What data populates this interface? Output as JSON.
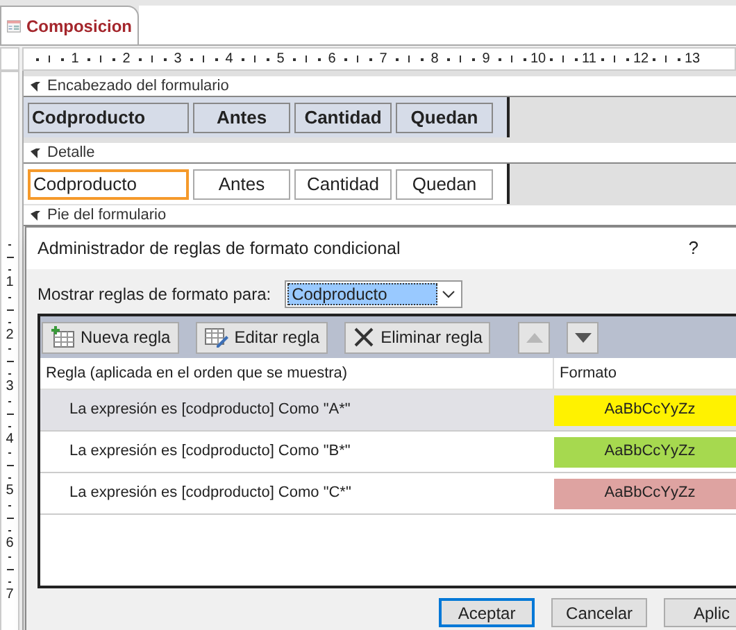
{
  "document_tab": {
    "title": "Composicion"
  },
  "ruler": {
    "top_marks": [
      "1",
      "2",
      "3",
      "4",
      "5",
      "6",
      "7",
      "8",
      "9",
      "10",
      "11",
      "12",
      "13"
    ],
    "side_marks": [
      "1",
      "2",
      "3",
      "4",
      "5",
      "6",
      "7"
    ]
  },
  "form": {
    "sections": [
      {
        "title": "Encabezado del formulario",
        "kind": "header",
        "controls": [
          {
            "text": "Codproducto",
            "selected": false
          },
          {
            "text": "Antes",
            "selected": false
          },
          {
            "text": "Cantidad",
            "selected": false
          },
          {
            "text": "Quedan",
            "selected": false
          }
        ]
      },
      {
        "title": "Detalle",
        "kind": "detail",
        "controls": [
          {
            "text": "Codproducto",
            "selected": true
          },
          {
            "text": "Antes",
            "selected": false
          },
          {
            "text": "Cantidad",
            "selected": false
          },
          {
            "text": "Quedan",
            "selected": false
          }
        ]
      },
      {
        "title": "Pie del formulario",
        "kind": "footer"
      }
    ]
  },
  "dialog": {
    "title": "Administrador de reglas de formato condicional",
    "help": "?",
    "show_label": "Mostrar reglas de formato para:",
    "show_value": "Codproducto",
    "toolbar": [
      {
        "kind": "new",
        "label": "Nueva regla",
        "disabled": false
      },
      {
        "kind": "edit",
        "label": "Editar regla",
        "disabled": false
      },
      {
        "kind": "delete",
        "label": "Eliminar regla",
        "disabled": false
      },
      {
        "kind": "up",
        "disabled": true
      },
      {
        "kind": "down",
        "disabled": false
      }
    ],
    "columns": [
      "Regla (aplicada en el orden que se muestra)",
      "Formato"
    ],
    "rules": [
      {
        "text": "La expresión es [codproducto] Como \"A*\"",
        "preview": "AaBbCcYyZz",
        "color": "#fff200",
        "selected": true
      },
      {
        "text": "La expresión es [codproducto] Como \"B*\"",
        "preview": "AaBbCcYyZz",
        "color": "#a6d94f",
        "selected": false
      },
      {
        "text": "La expresión es [codproducto] Como \"C*\"",
        "preview": "AaBbCcYyZz",
        "color": "#dea3a1",
        "selected": false
      }
    ],
    "buttons": [
      {
        "label": "Aceptar",
        "default": true
      },
      {
        "label": "Cancelar",
        "default": false
      },
      {
        "label": "Aplic",
        "default": false
      }
    ]
  }
}
